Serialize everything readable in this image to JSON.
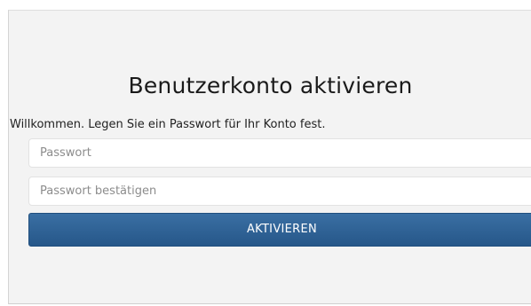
{
  "form": {
    "title": "Benutzerkonto aktivieren",
    "welcome_text": "Willkommen. Legen Sie ein Passwort für Ihr Konto fest.",
    "password_placeholder": "Passwort",
    "password_value": "",
    "confirm_placeholder": "Passwort bestätigen",
    "confirm_value": "",
    "submit_label": "AKTIVIEREN"
  },
  "colors": {
    "panel_background": "#f3f3f3",
    "button_primary": "#2d5f92",
    "button_text": "#ffffff"
  }
}
